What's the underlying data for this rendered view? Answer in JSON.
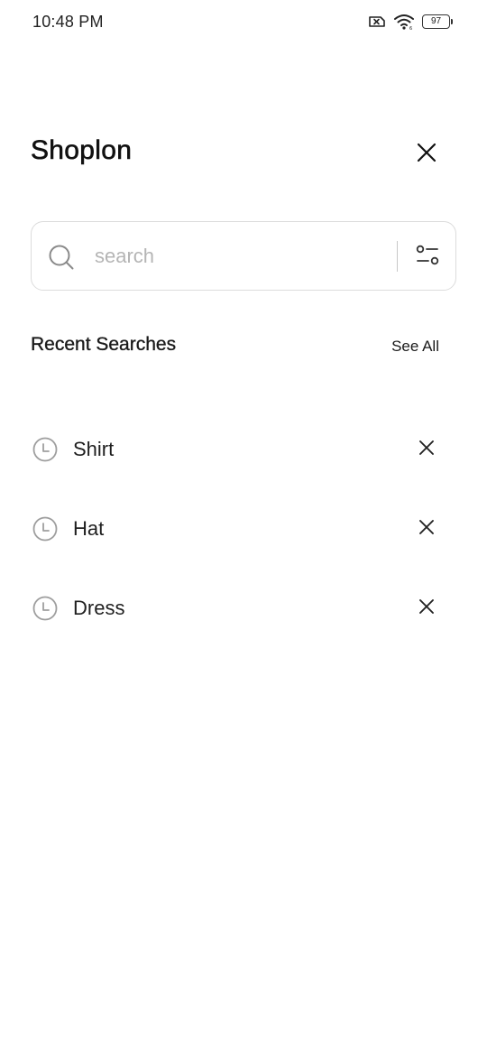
{
  "status_bar": {
    "time": "10:48 PM",
    "battery_level": "97",
    "icons": [
      "sim-x-icon",
      "wifi-icon",
      "battery-icon"
    ]
  },
  "header": {
    "brand": "Shoplon",
    "close_icon": "close-icon"
  },
  "search": {
    "placeholder": "search",
    "value": "",
    "icon": "search-icon",
    "filter_icon": "filter-icon"
  },
  "recent": {
    "title": "Recent Searches",
    "see_all_label": "See All",
    "items": [
      {
        "label": "Shirt",
        "icon": "clock-icon",
        "remove_icon": "close-icon"
      },
      {
        "label": "Hat",
        "icon": "clock-icon",
        "remove_icon": "close-icon"
      },
      {
        "label": "Dress",
        "icon": "clock-icon",
        "remove_icon": "close-icon"
      }
    ]
  },
  "colors": {
    "background": "#ffffff",
    "text": "#1a1a1a",
    "placeholder": "#b5b5b5",
    "border": "#dcdcdc",
    "icon_muted": "#9e9e9e"
  }
}
